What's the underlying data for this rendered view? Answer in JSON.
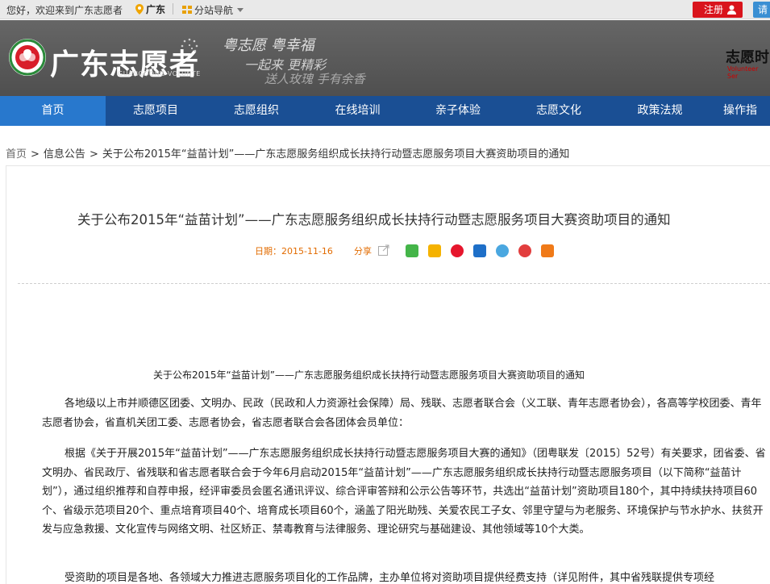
{
  "topbar": {
    "welcome": "您好，欢迎来到广东志愿者",
    "location": "广东",
    "site_nav": "分站导航",
    "register": "注册",
    "login": "请"
  },
  "header": {
    "logo_text": "广东志愿者",
    "logo_sub": "GUANGDONG VOLUNTE",
    "slogan_line1": "粤志愿 粤幸福",
    "slogan_line2": "一起来 更精彩",
    "slogan_line3": "送人玫瑰 手有余香",
    "right_brand": "志愿时",
    "right_brand_sub": "Volunteer Ser"
  },
  "mainnav": {
    "items": [
      {
        "label": "首页",
        "active": true
      },
      {
        "label": "志愿项目"
      },
      {
        "label": "志愿组织"
      },
      {
        "label": "在线培训"
      },
      {
        "label": "亲子体验"
      },
      {
        "label": "志愿文化"
      },
      {
        "label": "政策法规"
      },
      {
        "label": "操作指"
      }
    ]
  },
  "breadcrumb": {
    "home": "首页",
    "section": "信息公告",
    "current": "关于公布2015年“益苗计划”——广东志愿服务组织成长扶持行动暨志愿服务项目大赛资助项目的通知"
  },
  "article": {
    "title": "关于公布2015年“益苗计划”——广东志愿服务组织成长扶持行动暨志愿服务项目大赛资助项目的通知",
    "date_label": "日期：",
    "date": "2015-11-16",
    "share_label": "分享",
    "share_icons": [
      "wechat-icon",
      "qzone-icon",
      "weibo-icon",
      "renren-icon",
      "tencent-weibo-icon",
      "douban-icon",
      "more-icon"
    ],
    "body_title": "关于公布2015年“益苗计划”——广东志愿服务组织成长扶持行动暨志愿服务项目大赛资助项目的通知",
    "paragraph1": "各地级以上市并顺德区团委、文明办、民政（民政和人力资源社会保障）局、残联、志愿者联合会（义工联、青年志愿者协会），各高等学校团委、青年志愿者协会，省直机关团工委、志愿者协会，省志愿者联合会各团体会员单位：",
    "paragraph2": "根据《关于开展2015年“益苗计划”——广东志愿服务组织成长扶持行动暨志愿服务项目大赛的通知》（团粤联发〔2015〕52号）有关要求，团省委、省文明办、省民政厅、省残联和省志愿者联合会于今年6月启动2015年“益苗计划”——广东志愿服务组织成长扶持行动暨志愿服务项目（以下简称“益苗计划”），通过组织推荐和自荐申报，经评审委员会匿名通讯评议、综合评审答辩和公示公告等环节，共选出“益苗计划”资助项目180个，其中持续扶持项目60个、省级示范项目20个、重点培育项目40个、培育成长项目60个，涵盖了阳光助残、关爱农民工子女、邻里守望与为老服务、环境保护与节水护水、扶贫开发与应急救援、文化宣传与网络文明、社区矫正、禁毒教育与法律服务、理论研究与基础建设、其他领域等10个大类。",
    "paragraph3": "受资助的项目是各地、各领域大力推进志愿服务项目化的工作品牌，主办单位将对资助项目提供经费支持（详见附件，其中省残联提供专项经"
  }
}
